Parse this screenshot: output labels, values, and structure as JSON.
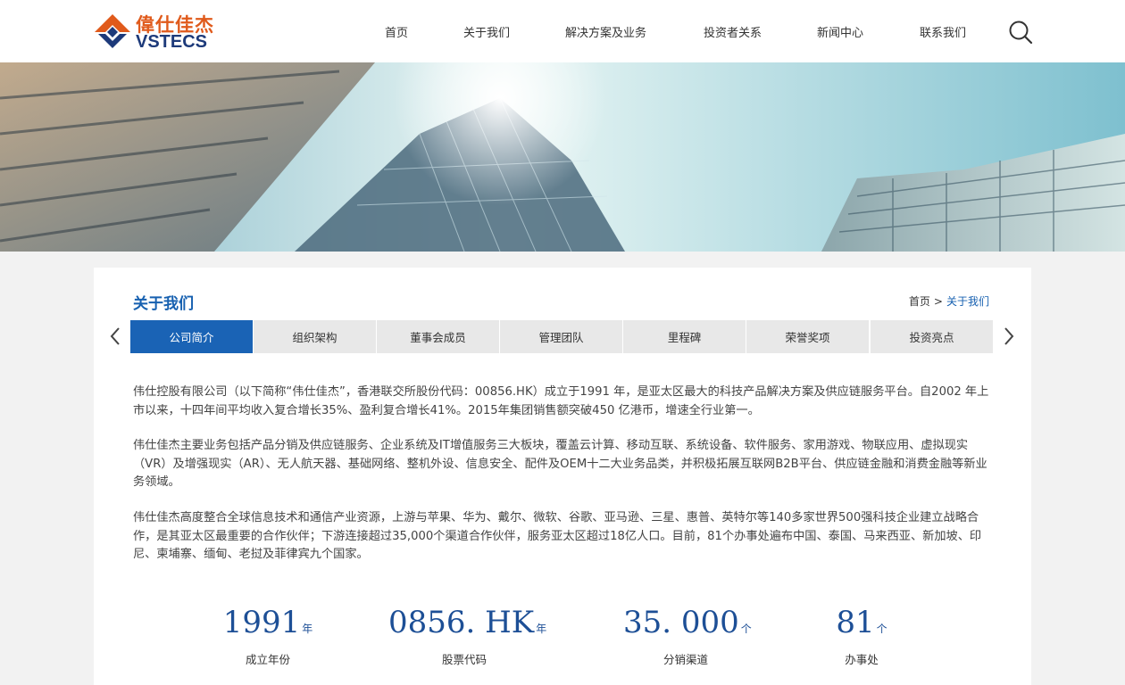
{
  "brand": {
    "name_cn": "偉仕佳杰",
    "name_en": "VSTECS",
    "colors": {
      "orange": "#e05a1b",
      "navy": "#1d3a7a",
      "accent": "#1660b0"
    }
  },
  "nav": {
    "items": [
      "首页",
      "关于我们",
      "解决方案及业务",
      "投资者关系",
      "新闻中心",
      "联系我们"
    ],
    "search_icon": "search-icon"
  },
  "section": {
    "title": "关于我们",
    "breadcrumb": {
      "home": "首页",
      "sep": ">",
      "current": "关于我们"
    }
  },
  "tabs": {
    "items": [
      "公司简介",
      "组织架构",
      "董事会成员",
      "管理团队",
      "里程碑",
      "荣誉奖项",
      "投资亮点"
    ],
    "active": "公司简介",
    "prev_icon": "chevron-left-icon",
    "next_icon": "chevron-right-icon"
  },
  "intro": {
    "paragraphs": [
      "伟仕控股有限公司（以下简称“伟仕佳杰”，香港联交所股份代码：00856.HK）成立于1991 年，是亚太区最大的科技产品解决方案及供应链服务平台。自2002 年上市以来，十四年间平均收入复合增长35%、盈利复合增长41%。2015年集团销售额突破450 亿港币，增速全行业第一。",
      "伟仕佳杰主要业务包括产品分销及供应链服务、企业系统及IT增值服务三大板块，覆盖云计算、移动互联、系统设备、软件服务、家用游戏、物联应用、虚拟现实（VR）及增强现实（AR）、无人航天器、基础网络、整机外设、信息安全、配件及OEM十二大业务品类，并积极拓展互联网B2B平台、供应链金融和消费金融等新业务领域。",
      "伟仕佳杰高度整合全球信息技术和通信产业资源，上游与苹果、华为、戴尔、微软、谷歌、亚马逊、三星、惠普、英特尔等140多家世界500强科技企业建立战略合作，是其亚太区最重要的合作伙伴；下游连接超过35,000个渠道合作伙伴，服务亚太区超过18亿人口。目前，81个办事处遍布中国、泰国、马来西亚、新加坡、印尼、柬埔寨、缅甸、老挝及菲律宾九个国家。"
    ]
  },
  "stats": [
    {
      "value": "1991",
      "unit": "年",
      "label": "成立年份"
    },
    {
      "value": "0856. HK",
      "unit": "年",
      "label": "股票代码"
    },
    {
      "value": "35. 000",
      "unit": "个",
      "label": "分销渠道"
    },
    {
      "value": "81",
      "unit": "个",
      "label": "办事处"
    }
  ]
}
